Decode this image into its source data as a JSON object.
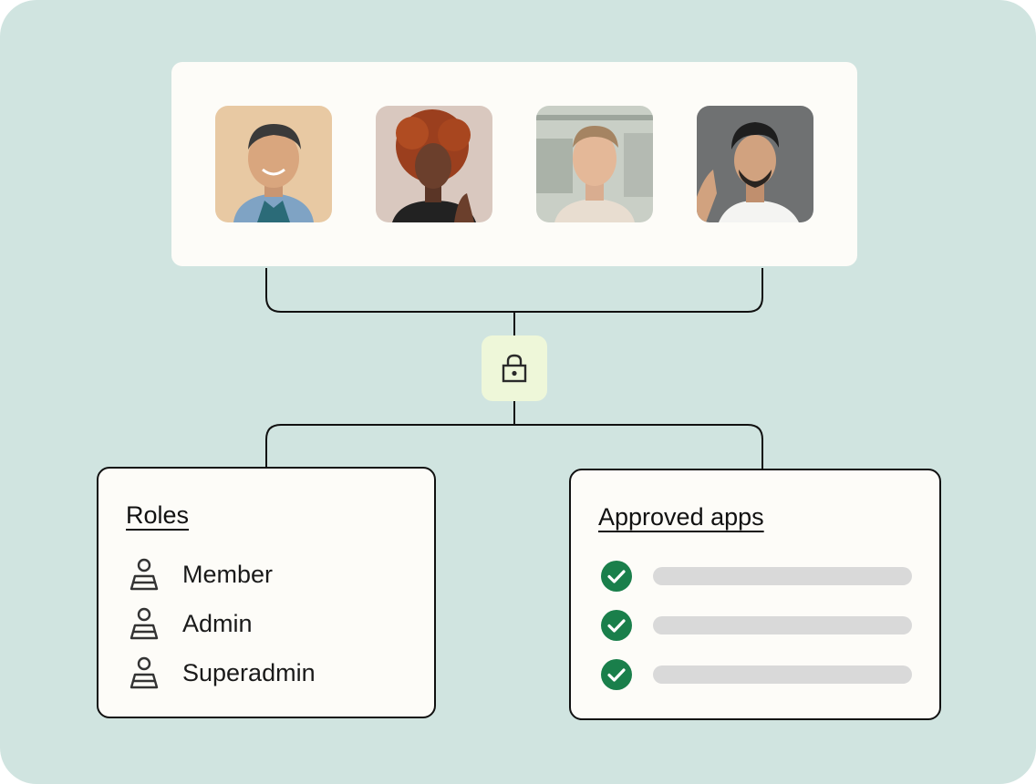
{
  "colors": {
    "background": "#d0e4e0",
    "card": "#fdfcf8",
    "lock_tile": "#eef7d9",
    "check_green": "#1a7f4b",
    "placeholder_bar": "#d9d9d9",
    "line": "#111111"
  },
  "people": [
    {
      "name": "avatar-person-1",
      "bg": "#e8c9a3"
    },
    {
      "name": "avatar-person-2",
      "bg": "#d9c8bf"
    },
    {
      "name": "avatar-person-3",
      "bg": "#c9cfc6"
    },
    {
      "name": "avatar-person-4",
      "bg": "#6f7172"
    }
  ],
  "lock": {
    "icon": "lock-icon"
  },
  "roles": {
    "title": "Roles",
    "items": [
      {
        "label": "Member",
        "icon": "user-icon"
      },
      {
        "label": "Admin",
        "icon": "user-icon"
      },
      {
        "label": "Superadmin",
        "icon": "user-icon"
      }
    ]
  },
  "apps": {
    "title": "Approved apps",
    "items": [
      {
        "icon": "check-circle-icon",
        "status": "approved"
      },
      {
        "icon": "check-circle-icon",
        "status": "approved"
      },
      {
        "icon": "check-circle-icon",
        "status": "approved"
      }
    ]
  }
}
